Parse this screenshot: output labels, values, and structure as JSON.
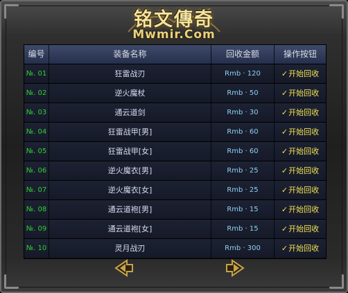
{
  "logo": {
    "title": "铭文傳奇",
    "sub": "Mwmir.Com"
  },
  "headers": {
    "id": "编号",
    "name": "装备名称",
    "price": "回收金额",
    "action": "操作按钮"
  },
  "rows": [
    {
      "id": "№. 01",
      "name": "狂雷战刃",
      "price": "Rmb · 120",
      "action": "开始回收"
    },
    {
      "id": "№. 02",
      "name": "逆火魔杖",
      "price": "Rmb · 50",
      "action": "开始回收"
    },
    {
      "id": "№. 03",
      "name": "通云道剑",
      "price": "Rmb · 30",
      "action": "开始回收"
    },
    {
      "id": "№. 04",
      "name": "狂雷战甲[男]",
      "price": "Rmb · 60",
      "action": "开始回收"
    },
    {
      "id": "№. 05",
      "name": "狂雷战甲[女]",
      "price": "Rmb · 60",
      "action": "开始回收"
    },
    {
      "id": "№. 06",
      "name": "逆火魔衣[男]",
      "price": "Rmb · 25",
      "action": "开始回收"
    },
    {
      "id": "№. 07",
      "name": "逆火魔衣[女]",
      "price": "Rmb · 25",
      "action": "开始回收"
    },
    {
      "id": "№. 08",
      "name": "通云道袍[男]",
      "price": "Rmb · 15",
      "action": "开始回收"
    },
    {
      "id": "№. 09",
      "name": "通云道袍[女]",
      "price": "Rmb · 15",
      "action": "开始回收"
    },
    {
      "id": "№. 10",
      "name": "灵月战刃",
      "price": "Rmb · 300",
      "action": "开始回收"
    }
  ],
  "colors": {
    "id": "#2fd12f",
    "price": "#8fd0f5",
    "action": "#f0e050",
    "arrow": "#c9a24a"
  }
}
